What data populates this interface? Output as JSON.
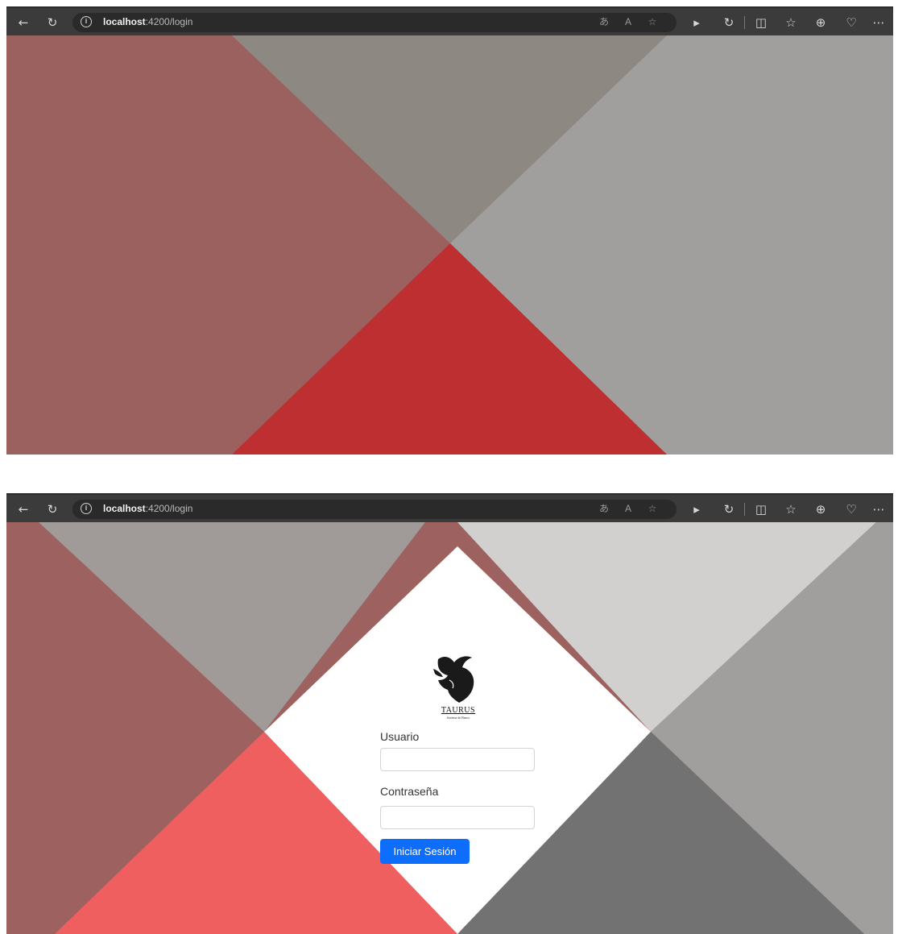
{
  "browser": {
    "url_host": "localhost",
    "url_path": ":4200/login",
    "icons": {
      "back": "back-arrow-icon",
      "reload": "reload-icon",
      "info": "info-icon",
      "translate": "translate-icon",
      "read_aloud": "read-aloud-icon",
      "favorite": "favorite-star-icon",
      "copilot": "copilot-icon",
      "extension": "extension-icon",
      "split": "split-screen-icon",
      "favorites": "favorites-list-icon",
      "collections": "collections-icon",
      "browser_essentials": "browser-essentials-icon",
      "more": "more-options-icon"
    }
  },
  "login": {
    "logo_text": "TAURUS",
    "logo_subtext": "Sistema de Banco",
    "username_label": "Usuario",
    "username_value": "",
    "password_label": "Contraseña",
    "password_value": "",
    "submit_label": "Iniciar Sesión"
  },
  "colors": {
    "browser_toolbar": "#3b3b3b",
    "url_bar": "#2a2a2a",
    "shot1_left": "#9b615e",
    "shot1_top": "#8e8883",
    "shot1_right": "#a19f9d",
    "shot1_bottom": "#be2f31",
    "shot2_left": "#9d625f",
    "shot2_top_left": "#a09a98",
    "shot2_top_right": "#d1d0ce",
    "shot2_right": "#a19f9d",
    "shot2_bottom_left": "#f05f5f",
    "shot2_bottom_right": "#727272",
    "center": "#ffffff",
    "button": "#0d6efd"
  }
}
